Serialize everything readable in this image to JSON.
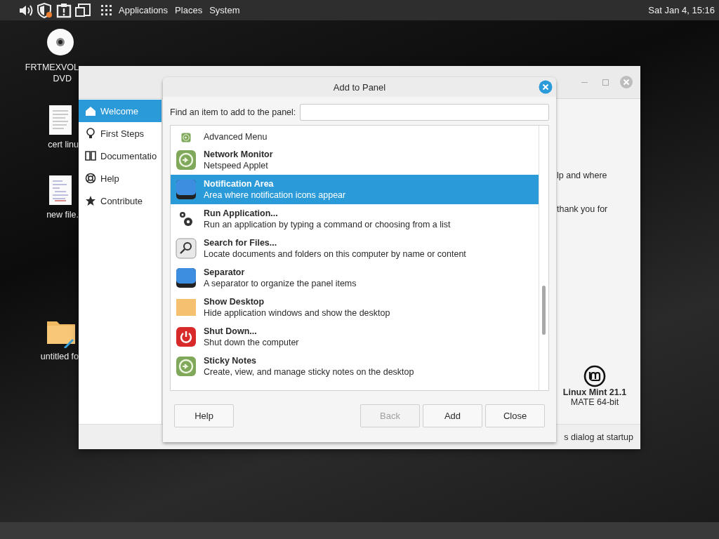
{
  "top_panel": {
    "menus": [
      "Applications",
      "Places",
      "System"
    ],
    "clock": "Sat Jan 4, 15:16"
  },
  "desktop_icons": [
    {
      "kind": "disc",
      "lines": [
        "FRTMEXVOL",
        "DVD"
      ]
    },
    {
      "kind": "document",
      "lines": [
        "cert linu"
      ]
    },
    {
      "kind": "script",
      "lines": [
        "new file."
      ]
    },
    {
      "kind": "folder",
      "lines": [
        "untitled fo"
      ]
    }
  ],
  "welcome_window": {
    "sidebar": [
      {
        "label": "Welcome",
        "selected": true
      },
      {
        "label": "First Steps",
        "selected": false
      },
      {
        "label": "Documentatio",
        "selected": false
      },
      {
        "label": "Help",
        "selected": false
      },
      {
        "label": "Contribute",
        "selected": false
      }
    ],
    "content_fragments": [
      "lp and where",
      "thank you for"
    ],
    "version": "Linux Mint 21.1",
    "edition": "MATE 64-bit",
    "footer_text": "s dialog at startup"
  },
  "dialog": {
    "title": "Add to Panel",
    "search_label": "Find an item to add to the panel:",
    "items": [
      {
        "kind": "applet",
        "description": "Advanced Menu",
        "selected": false
      },
      {
        "kind": "applet",
        "name": "Network Monitor",
        "description": "Netspeed Applet",
        "selected": false
      },
      {
        "kind": "panel",
        "name": "Notification Area",
        "description": "Area where notification icons appear",
        "selected": true
      },
      {
        "kind": "gears",
        "name": "Run Application...",
        "description": "Run an application by typing a command or choosing from a list",
        "selected": false
      },
      {
        "kind": "search",
        "name": "Search for Files...",
        "description": "Locate documents and folders on this computer by name or content",
        "selected": false
      },
      {
        "kind": "panel",
        "name": "Separator",
        "description": "A separator to organize the panel items",
        "selected": false
      },
      {
        "kind": "desktop",
        "name": "Show Desktop",
        "description": "Hide application windows and show the desktop",
        "selected": false
      },
      {
        "kind": "power",
        "name": "Shut Down...",
        "description": "Shut down the computer",
        "selected": false
      },
      {
        "kind": "applet",
        "name": "Sticky Notes",
        "description": "Create, view, and manage sticky notes on the desktop",
        "selected": false
      }
    ],
    "buttons": [
      {
        "label": "Help",
        "disabled": false
      },
      {
        "label": "Back",
        "disabled": true
      },
      {
        "label": "Add",
        "disabled": false
      },
      {
        "label": "Close",
        "disabled": false
      }
    ]
  }
}
